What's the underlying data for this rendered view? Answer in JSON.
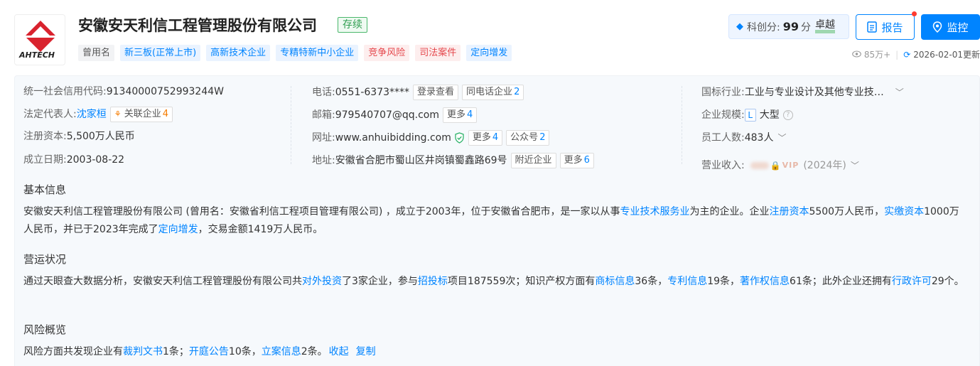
{
  "company": {
    "logo_text": "AHTECH",
    "name": "安徽安天利信工程管理股份有限公司",
    "status": "存续",
    "tags": [
      {
        "label": "曾用名",
        "tone": "gray"
      },
      {
        "label": "新三板(正常上市)",
        "tone": "blue"
      },
      {
        "label": "高新技术企业",
        "tone": "blue"
      },
      {
        "label": "专精特新中小企业",
        "tone": "blue"
      },
      {
        "label": "竞争风险",
        "tone": "red"
      },
      {
        "label": "司法案件",
        "tone": "red"
      },
      {
        "label": "定向增发",
        "tone": "blue"
      }
    ]
  },
  "score": {
    "label": "科创分:",
    "value": "99",
    "unit": "分",
    "level": "卓越"
  },
  "actions": {
    "report": "报告",
    "monitor": "监控"
  },
  "meta": {
    "views": "85万+",
    "updated": "2026-02-01更新"
  },
  "info": {
    "credit_code": {
      "label": "统一社会信用代码:",
      "value": "91340000752993244W"
    },
    "legal_rep": {
      "label": "法定代表人:",
      "value": "沈家桓",
      "related": "关联企业",
      "related_count": "4"
    },
    "capital": {
      "label": "注册资本:",
      "value": "5,500万人民币"
    },
    "founded": {
      "label": "成立日期:",
      "value": "2003-08-22"
    },
    "phone": {
      "label": "电话:",
      "value": "0551-6373****",
      "login": "登录查看",
      "same": "同电话企业",
      "same_count": "2"
    },
    "email": {
      "label": "邮箱:",
      "value": "979540707@qq.com",
      "more": "更多",
      "more_count": "4"
    },
    "website": {
      "label": "网址:",
      "value": "www.anhuibidding.com",
      "more": "更多",
      "more_count": "4",
      "wechat": "公众号",
      "wechat_count": "2"
    },
    "address": {
      "label": "地址:",
      "value": "安徽省合肥市蜀山区井岗镇蜀鑫路69号",
      "nearby": "附近企业",
      "more": "更多",
      "more_count": "6"
    },
    "industry": {
      "label": "国标行业:",
      "value": "工业与专业设计及其他专业技…"
    },
    "scale": {
      "label": "企业规模:",
      "badge": "L",
      "value": "大型"
    },
    "staff": {
      "label": "员工人数:",
      "value": "483人"
    },
    "revenue": {
      "label": "营业收入:",
      "vip": "VIP",
      "year": "(2024年)"
    }
  },
  "sections": {
    "basic_title": "基本信息",
    "basic": {
      "t1": "安徽安天利信工程管理股份有限公司 (曾用名：安徽省利信工程项目管理有限公司) ，成立于2003年，位于安徽省合肥市，是一家以从事",
      "l1": "专业技术服务业",
      "t2": "为主的企业。企业",
      "l2": "注册资本",
      "t3": "5500万人民币，",
      "l3": "实缴资本",
      "t4": "1000万人民币，并已于2023年完成了",
      "l4": "定向增发",
      "t5": "，交易金额1419万人民币。"
    },
    "ops_title": "营运状况",
    "ops": {
      "t1": "通过天眼查大数据分析，安徽安天利信工程管理股份有限公司共",
      "l1": "对外投资",
      "t2": "了3家企业，参与",
      "l2": "招投标",
      "t3": "项目187559次；知识产权方面有",
      "l3": "商标信息",
      "t4": "36条，",
      "l4": "专利信息",
      "t5": "19条，",
      "l5": "著作权信息",
      "t6": "61条；此外企业还拥有",
      "l6": "行政许可",
      "t7": "29个。"
    },
    "risk_title": "风险概览",
    "risk": {
      "t1": "风险方面共发现企业有",
      "l1": "裁判文书",
      "t2": "1条；",
      "l2": "开庭公告",
      "t3": "10条，",
      "l3": "立案信息",
      "t4": "2条。",
      "collapse": "收起",
      "copy": "复制"
    }
  },
  "colors": {
    "accent": "#0084ff",
    "logo_red": "#d9232e",
    "status_green": "#2f9e50",
    "danger": "#e5484d"
  }
}
